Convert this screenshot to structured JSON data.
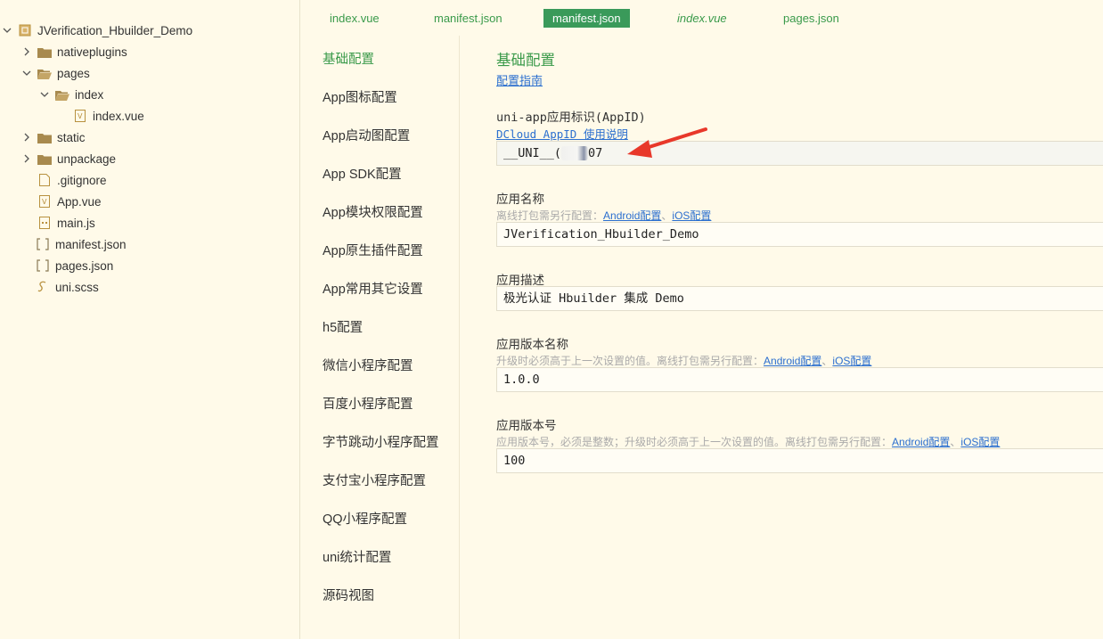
{
  "tree": {
    "items": [
      {
        "label": "JVerification_Hbuilder_Demo",
        "chevron": "down",
        "icon": "project-icon"
      },
      {
        "label": "nativeplugins",
        "chevron": "right",
        "icon": "folder-icon"
      },
      {
        "label": "pages",
        "chevron": "down",
        "icon": "folder-open-icon"
      },
      {
        "label": "index",
        "chevron": "down",
        "icon": "folder-open-icon"
      },
      {
        "label": "index.vue",
        "chevron": "",
        "icon": "vue-file-icon"
      },
      {
        "label": "static",
        "chevron": "right",
        "icon": "folder-icon"
      },
      {
        "label": "unpackage",
        "chevron": "right",
        "icon": "folder-icon"
      },
      {
        "label": ".gitignore",
        "chevron": "",
        "icon": "file-icon"
      },
      {
        "label": "App.vue",
        "chevron": "",
        "icon": "vue-file-icon"
      },
      {
        "label": "main.js",
        "chevron": "",
        "icon": "js-file-icon"
      },
      {
        "label": "manifest.json",
        "chevron": "",
        "icon": "json-file-icon"
      },
      {
        "label": "pages.json",
        "chevron": "",
        "icon": "json-file-icon"
      },
      {
        "label": "uni.scss",
        "chevron": "",
        "icon": "scss-file-icon"
      }
    ]
  },
  "tabs": [
    {
      "label": "index.vue",
      "active": false,
      "italic": false
    },
    {
      "label": "manifest.json",
      "active": false,
      "italic": false
    },
    {
      "label": "manifest.json",
      "active": true,
      "italic": false
    },
    {
      "label": "index.vue",
      "active": false,
      "italic": true
    },
    {
      "label": "pages.json",
      "active": false,
      "italic": false
    }
  ],
  "nav": {
    "items": [
      "基础配置",
      "App图标配置",
      "App启动图配置",
      "App SDK配置",
      "App模块权限配置",
      "App原生插件配置",
      "App常用其它设置",
      "h5配置",
      "微信小程序配置",
      "百度小程序配置",
      "字节跳动小程序配置",
      "支付宝小程序配置",
      "QQ小程序配置",
      "uni统计配置",
      "源码视图"
    ],
    "active_index": 0
  },
  "main": {
    "title": "基础配置",
    "guide_link": "配置指南",
    "appid": {
      "label": "uni-app应用标识(AppID)",
      "link": "DCloud AppID 使用说明",
      "value_prefix": "__UNI__",
      "value_visible_a": "(",
      "value_visible_b": "07"
    },
    "app_name": {
      "label": "应用名称",
      "sub_prefix": "离线打包需另行配置：",
      "sub_link_android": "Android配置",
      "sub_sep": "、",
      "sub_link_ios": "iOS配置",
      "value": "JVerification_Hbuilder_Demo"
    },
    "app_desc": {
      "label": "应用描述",
      "value": "极光认证 Hbuilder 集成 Demo"
    },
    "version_name": {
      "label": "应用版本名称",
      "sub_prefix": "升级时必须高于上一次设置的值。离线打包需另行配置：",
      "sub_link_android": "Android配置",
      "sub_sep": "、",
      "sub_link_ios": "iOS配置",
      "value": "1.0.0"
    },
    "version_code": {
      "label": "应用版本号",
      "sub_prefix": "应用版本号，必须是整数；升级时必须高于上一次设置的值。离线打包需另行配置：",
      "sub_link_android": "Android配置",
      "sub_sep": "、",
      "sub_link_ios": "iOS配置",
      "value": "100"
    }
  },
  "colors": {
    "background": "#fffae9",
    "accent_green": "#3a9a4a",
    "link_blue": "#2b6fcf",
    "annotation_arrow": "#e8382a"
  }
}
